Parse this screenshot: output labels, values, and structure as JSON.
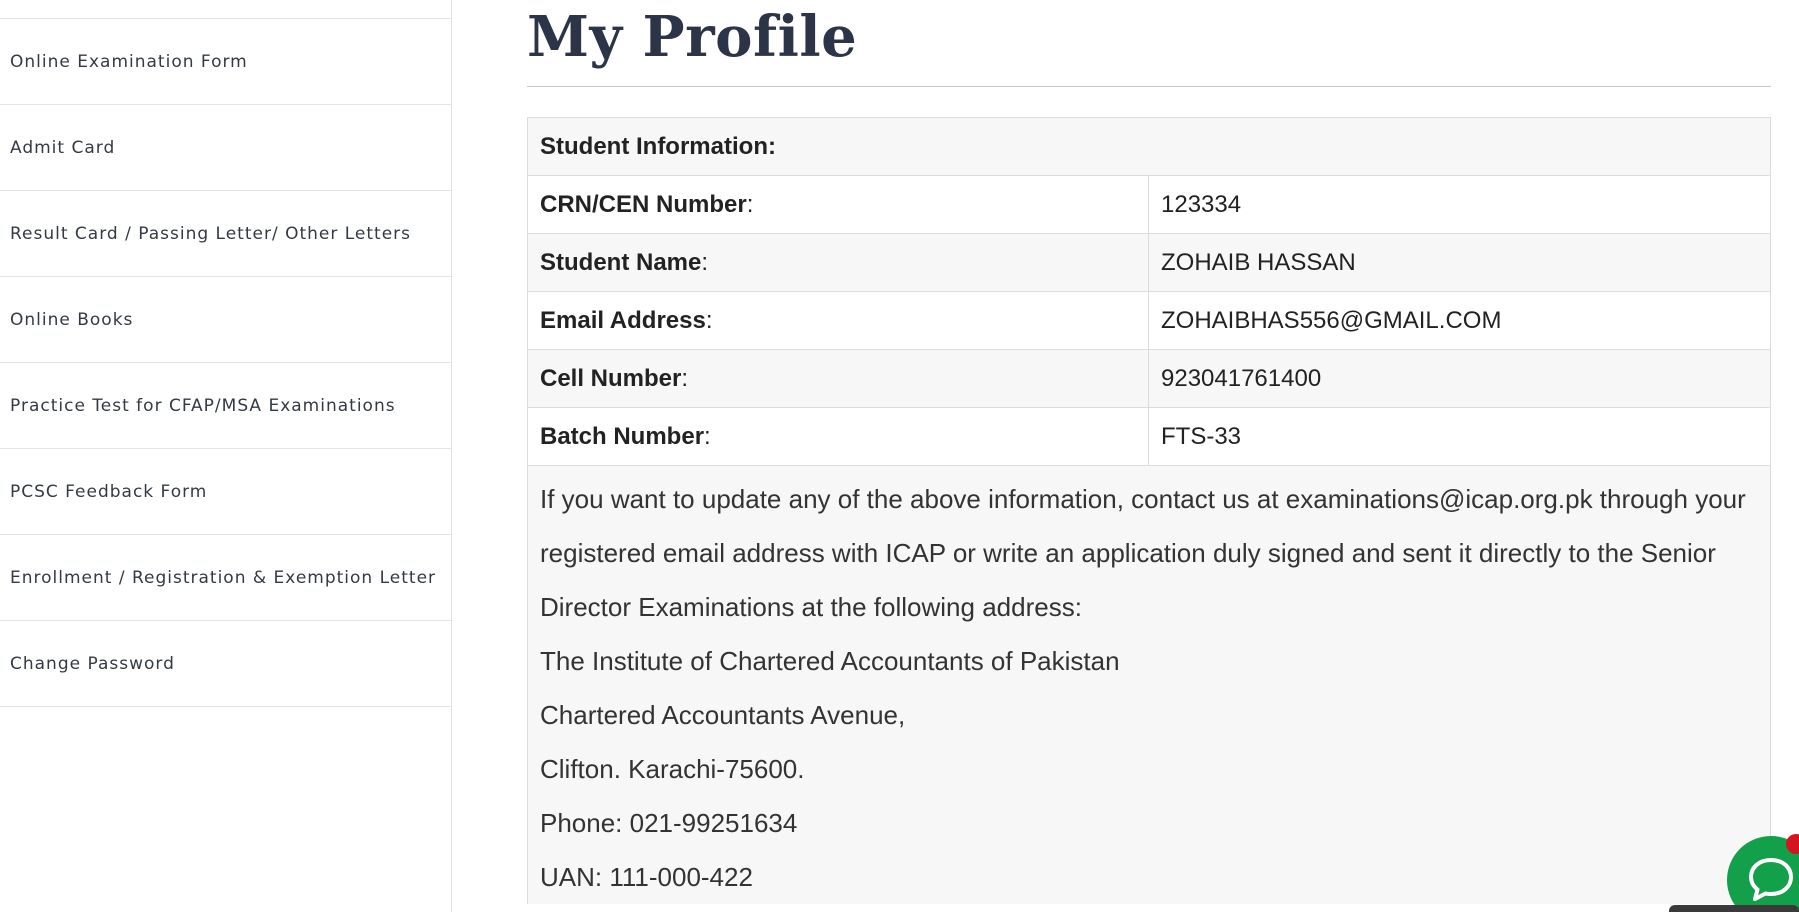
{
  "sidebar": {
    "items": [
      {
        "label": "Online Examination Form"
      },
      {
        "label": "Admit Card"
      },
      {
        "label": "Result Card / Passing Letter/ Other Letters"
      },
      {
        "label": "Online Books"
      },
      {
        "label": "Practice Test for CFAP/MSA Examinations"
      },
      {
        "label": "PCSC Feedback Form"
      },
      {
        "label": "Enrollment / Registration & Exemption Letter"
      },
      {
        "label": "Change Password"
      }
    ]
  },
  "main": {
    "title": "My Profile",
    "table": {
      "heading": "Student Information:",
      "rows": [
        {
          "label": "CRN/CEN Number",
          "value": "123334"
        },
        {
          "label": "Student Name",
          "value": "ZOHAIB HASSAN"
        },
        {
          "label": "Email Address",
          "value": "ZOHAIBHAS556@GMAIL.COM"
        },
        {
          "label": "Cell Number",
          "value": "923041761400"
        },
        {
          "label": "Batch Number",
          "value": "FTS-33"
        }
      ],
      "label_suffix": ":"
    },
    "notes": {
      "intro": "If you want to update any of the above information, contact us at examinations@icap.org.pk through your registered email address with ICAP or write an application duly signed and sent it directly to the Senior Director Examinations at the following address:",
      "address_line1": "The Institute of Chartered Accountants of Pakistan",
      "address_line2": "Chartered Accountants Avenue,",
      "address_line3": "Clifton. Karachi-75600.",
      "phone": "Phone: 021-99251634",
      "uan": "UAN: 111-000-422"
    }
  },
  "colors": {
    "title": "#2b3547",
    "chat_widget": "#13a04a",
    "chat_badge": "#d3151f",
    "row_alt": "#f7f7f7"
  },
  "icons": {
    "chat": "chat-bubble-icon"
  }
}
